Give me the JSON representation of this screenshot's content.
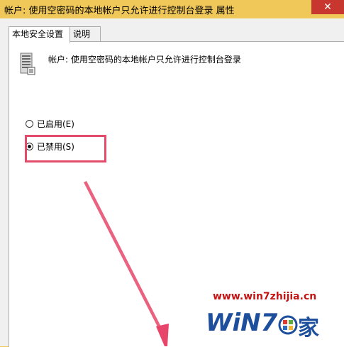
{
  "window": {
    "title": "帐户: 使用空密码的本地帐户只允许进行控制台登录 属性",
    "close_glyph": "✕"
  },
  "tabs": [
    {
      "label": "本地安全设置",
      "active": true
    },
    {
      "label": "说明",
      "active": false
    }
  ],
  "policy": {
    "icon": "server-policy-icon",
    "title": "帐户: 使用空密码的本地帐户只允许进行控制台登录"
  },
  "options": [
    {
      "label": "已启用(E)",
      "checked": false
    },
    {
      "label": "已禁用(S)",
      "checked": true
    }
  ],
  "watermark": {
    "url": "www.win7zhijia.cn",
    "logo_text": "WiN7",
    "logo_char": "家"
  },
  "colors": {
    "titlebar": "#f0c85a",
    "close": "#c7372f",
    "highlight": "#e44a6a",
    "arrow": "#e8456a",
    "watermark_red": "#c41414",
    "watermark_blue": "#1d4f9c"
  }
}
